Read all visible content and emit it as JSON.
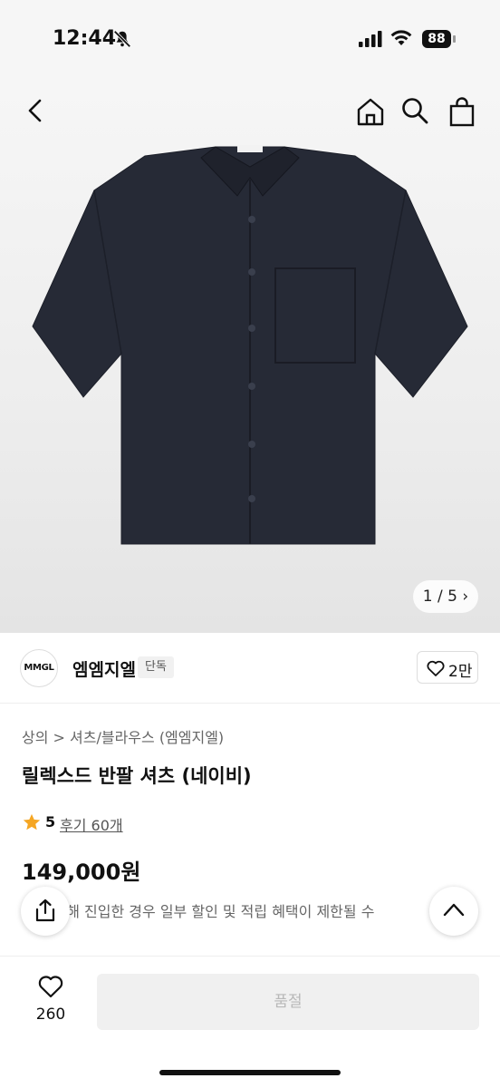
{
  "status_bar": {
    "time": "12:44",
    "battery": "88",
    "icons": [
      "bell-off-icon",
      "signal-icon",
      "wifi-icon",
      "battery-icon"
    ]
  },
  "nav": {
    "icons": [
      "back-icon",
      "home-icon",
      "search-icon",
      "bag-icon"
    ]
  },
  "gallery": {
    "current": 1,
    "total": 5,
    "pager_text": "1 / 5"
  },
  "brand": {
    "logo_text": "MMGL",
    "name": "엠엠지엘",
    "badge": "단독",
    "likes": "2만"
  },
  "product": {
    "breadcrumb": "상의 > 셔츠/블라우스 (엠엠지엘)",
    "title": "릴렉스드 반팔 셔츠 (네이비)",
    "rating": "5",
    "review_label": "후기 60개",
    "price": "149,000원",
    "notice": "크를 통해 진입한 경우 일부 할인 및 적립 혜택이 제한될 수"
  },
  "bottom_bar": {
    "wish_count": "260",
    "buy_label": "품절"
  },
  "colors": {
    "accent_star": "#f5a623",
    "shirt": "#262a36",
    "disabled_bg": "#f0f0f0"
  }
}
